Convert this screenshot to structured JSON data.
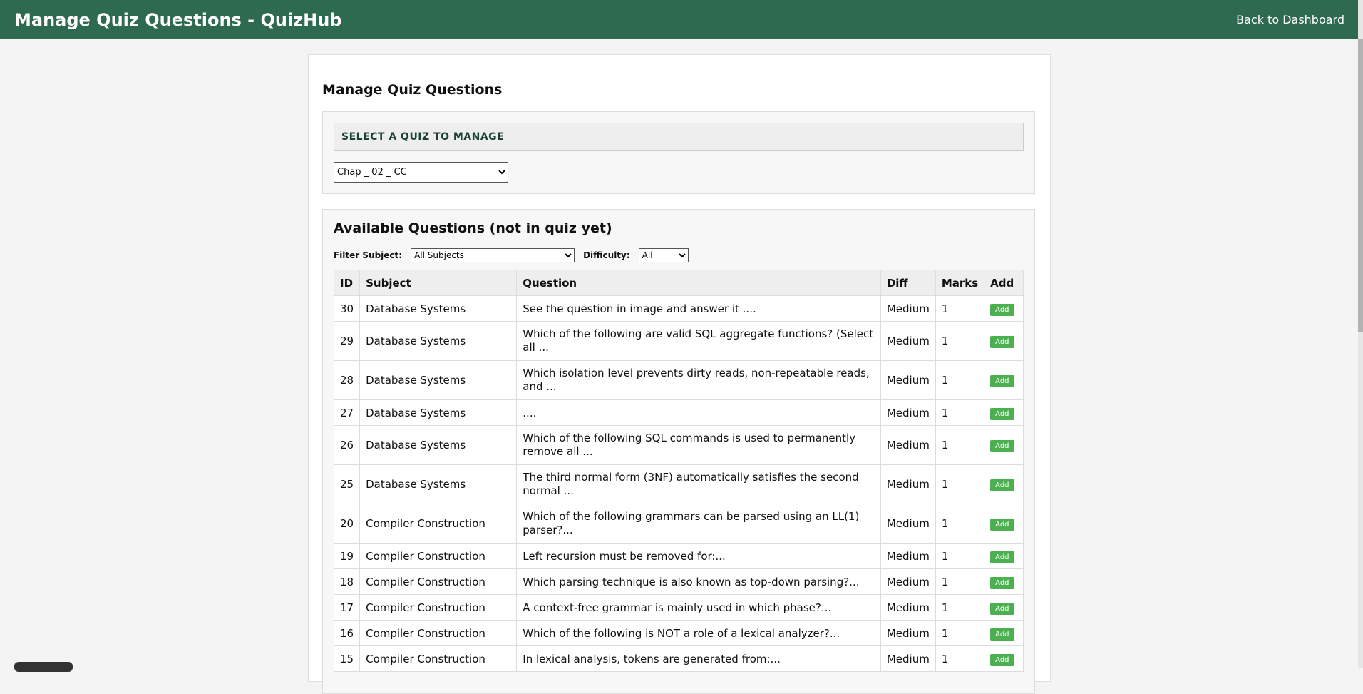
{
  "header": {
    "title": "Manage Quiz Questions - QuizHub",
    "back_link": "Back to Dashboard"
  },
  "page": {
    "title": "Manage Quiz Questions"
  },
  "quiz_select": {
    "label": "SELECT A QUIZ TO MANAGE",
    "selected": "Chap _ 02 _ CC"
  },
  "available": {
    "title": "Available Questions (not in quiz yet)",
    "filter_subject_label": "Filter Subject:",
    "filter_subject_value": "All Subjects",
    "difficulty_label": "Difficulty:",
    "difficulty_value": "All",
    "columns": [
      "ID",
      "Subject",
      "Question",
      "Diff",
      "Marks",
      "Add"
    ],
    "add_label": "Add",
    "rows": [
      {
        "id": "30",
        "subject": "Database Systems",
        "question": "See the question in image and answer it ....",
        "diff": "Medium",
        "marks": "1"
      },
      {
        "id": "29",
        "subject": "Database Systems",
        "question": "Which of the following are valid SQL aggregate functions? (Select all ...",
        "diff": "Medium",
        "marks": "1"
      },
      {
        "id": "28",
        "subject": "Database Systems",
        "question": "Which isolation level prevents dirty reads, non-repeatable reads, and ...",
        "diff": "Medium",
        "marks": "1"
      },
      {
        "id": "27",
        "subject": "Database Systems",
        "question": "....",
        "diff": "Medium",
        "marks": "1"
      },
      {
        "id": "26",
        "subject": "Database Systems",
        "question": "Which of the following SQL commands is used to permanently remove all ...",
        "diff": "Medium",
        "marks": "1"
      },
      {
        "id": "25",
        "subject": "Database Systems",
        "question": "The third normal form (3NF) automatically satisfies the second normal ...",
        "diff": "Medium",
        "marks": "1"
      },
      {
        "id": "20",
        "subject": "Compiler Construction",
        "question": "Which of the following grammars can be parsed using an LL(1) parser?...",
        "diff": "Medium",
        "marks": "1"
      },
      {
        "id": "19",
        "subject": "Compiler Construction",
        "question": "Left recursion must be removed for:...",
        "diff": "Medium",
        "marks": "1"
      },
      {
        "id": "18",
        "subject": "Compiler Construction",
        "question": "Which parsing technique is also known as top-down parsing?...",
        "diff": "Medium",
        "marks": "1"
      },
      {
        "id": "17",
        "subject": "Compiler Construction",
        "question": "A context-free grammar is mainly used in which phase?...",
        "diff": "Medium",
        "marks": "1"
      },
      {
        "id": "16",
        "subject": "Compiler Construction",
        "question": "Which of the following is NOT a role of a lexical analyzer?...",
        "diff": "Medium",
        "marks": "1"
      },
      {
        "id": "15",
        "subject": "Compiler Construction",
        "question": "In lexical analysis, tokens are generated from:...",
        "diff": "Medium",
        "marks": "1"
      }
    ]
  }
}
